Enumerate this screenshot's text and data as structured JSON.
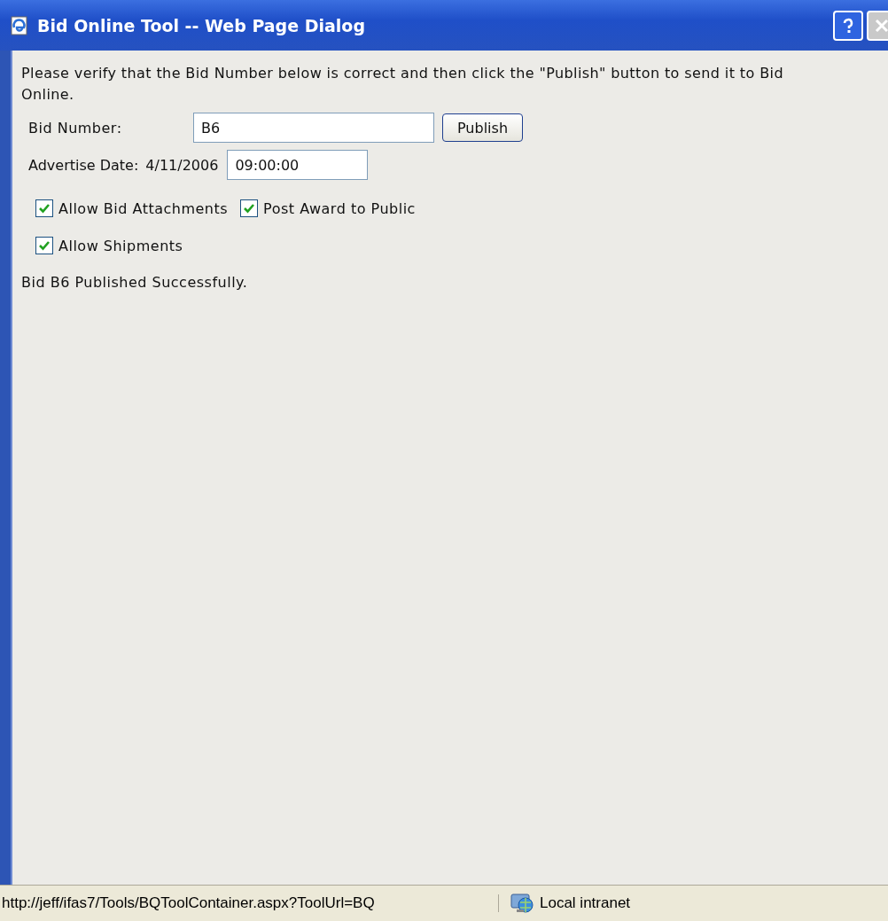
{
  "window": {
    "title": "Bid Online Tool -- Web Page Dialog"
  },
  "instructions": "Please verify that the Bid Number below is correct and then click the \"Publish\" button to send it to Bid Online.",
  "bid_number": {
    "label": "Bid Number:",
    "value": "B6",
    "button": "Publish"
  },
  "advertise": {
    "label": "Advertise Date:",
    "date": "4/11/2006",
    "time": "09:00:00"
  },
  "options": [
    {
      "label": "Allow Bid Attachments",
      "checked": true
    },
    {
      "label": "Post Award to Public",
      "checked": true
    },
    {
      "label": "Allow Shipments",
      "checked": true
    }
  ],
  "message": "Bid B6 Published Successfully.",
  "status_bar": {
    "url": "http://jeff/ifas7/Tools/BQToolContainer.aspx?ToolUrl=BQ",
    "zone": "Local intranet"
  }
}
